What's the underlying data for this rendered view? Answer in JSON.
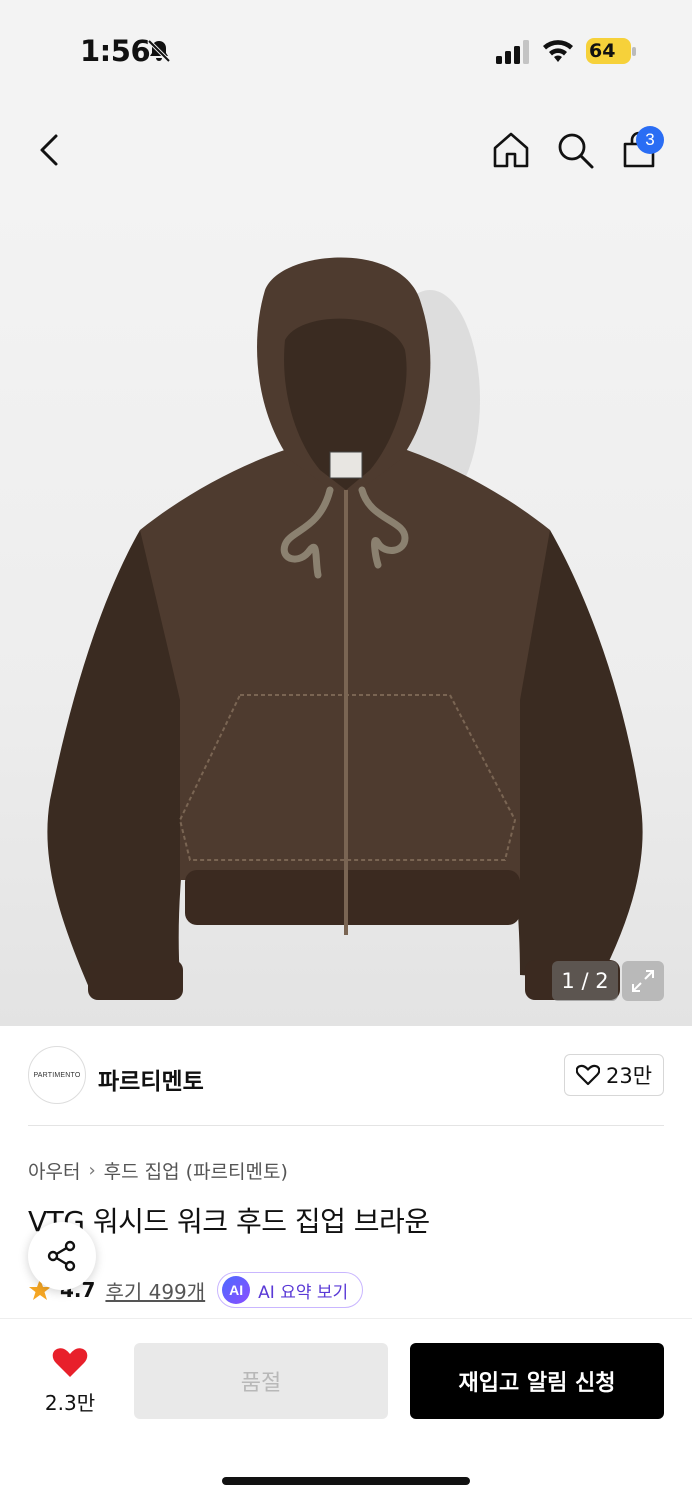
{
  "status_bar": {
    "time": "1:56",
    "battery": "64"
  },
  "nav": {
    "cart_count": "3"
  },
  "gallery": {
    "counter": "1 / 2",
    "jacket_colors": {
      "body": "#4e3b2f",
      "shadow": "#3a2b21",
      "stitch": "#7a6553",
      "drawcord": "#8b8170",
      "rib": "#3b2a20"
    }
  },
  "brand": {
    "logo_text": "PARTIMENTO",
    "name": "파르티멘토",
    "likes": "23만"
  },
  "product": {
    "breadcrumb": [
      "아우터",
      "후드 집업 (파르티멘토)"
    ],
    "title": "VTG 워시드 워크 후드 집업 브라운",
    "rating": "4.7",
    "review_label": "후기 499개",
    "ai_badge": "AI",
    "ai_summary_label": "AI 요약 보기"
  },
  "bottom_bar": {
    "wish_count": "2.3만",
    "soldout_label": "품절",
    "restock_label": "재입고 알림 신청"
  },
  "colors": {
    "accent_blue": "#2a6df4",
    "heart_red": "#e8202b",
    "star": "#f5a623",
    "ai_purple": "#5a3ad6"
  }
}
